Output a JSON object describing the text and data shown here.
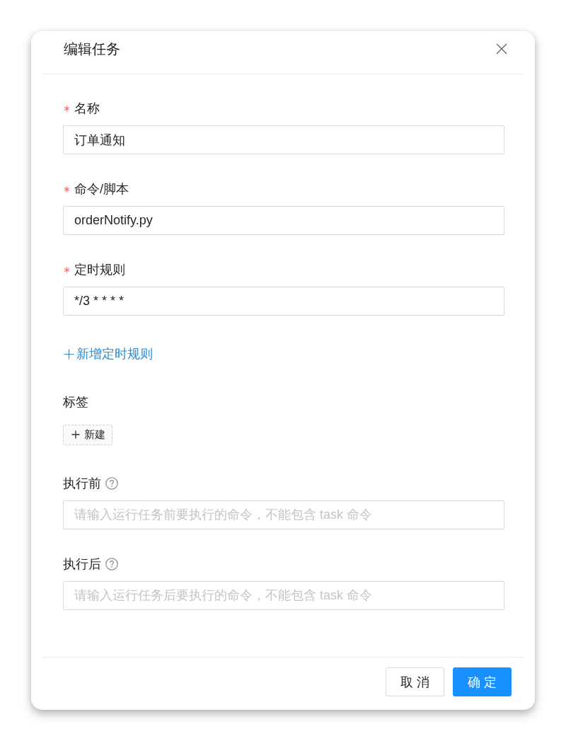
{
  "dialog": {
    "title": "编辑任务"
  },
  "form": [
    {
      "kind": "input",
      "label": "名称",
      "required": true,
      "help": false,
      "value": "订单通知"
    },
    {
      "kind": "input",
      "label": "命令/脚本",
      "required": true,
      "help": false,
      "value": "orderNotify.py"
    },
    {
      "kind": "input",
      "label": "定时规则",
      "required": true,
      "help": false,
      "value": "*/3 * * * *"
    },
    {
      "kind": "link",
      "text": "新增定时规则"
    },
    {
      "kind": "tags",
      "label": "标签",
      "required": false,
      "help": false,
      "add_text": "新建"
    },
    {
      "kind": "input",
      "label": "执行前",
      "required": false,
      "help": true,
      "placeholder": "请输入运行任务前要执行的命令，不能包含 task 命令"
    },
    {
      "kind": "input",
      "label": "执行后",
      "required": false,
      "help": true,
      "placeholder": "请输入运行任务后要执行的命令，不能包含 task 命令"
    }
  ],
  "buttons": [
    {
      "label": "取 消",
      "kind": "default"
    },
    {
      "label": "确 定",
      "kind": "primary"
    }
  ]
}
